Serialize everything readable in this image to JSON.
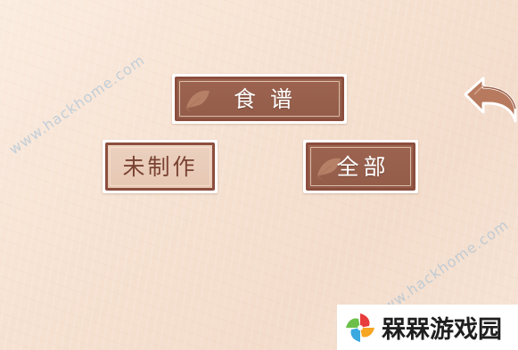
{
  "watermark": {
    "text": "www.hackhome.com"
  },
  "menu": {
    "recipe_title": "食谱",
    "unmade_label": "未制作",
    "all_label": "全部"
  },
  "nav": {
    "back_icon": "back-arrow-icon"
  },
  "branding": {
    "site_name": "槑槑游戏园",
    "logo_icon": "pinwheel-logo-icon"
  },
  "colors": {
    "board_dark": "#9c6450",
    "board_light": "#ecd1c0",
    "board_border": "#8c4e3e",
    "light_text": "#7a4232",
    "background": "#f6e2d2",
    "back_arrow": "#b77a5e"
  }
}
